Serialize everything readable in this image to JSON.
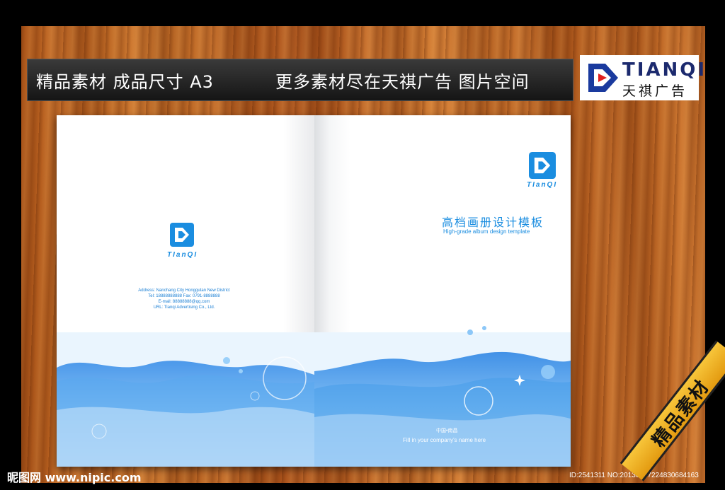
{
  "header": {
    "left_text": "精品素材 成品尺寸 A3",
    "right_text": "更多素材尽在天祺广告 图片空间"
  },
  "brand": {
    "name_en": "TIANQI",
    "name_cn": "天祺广告",
    "colors": {
      "blue": "#1a3a9e",
      "red": "#e02020"
    }
  },
  "left_page": {
    "logo_text": "TIanQI",
    "contact": {
      "address": "Address: Nanchang City Honggutan New District",
      "tel": "Tel: 18888888888      Fax: 0791-8888888",
      "email": "E-mail: 88888888@qq.com",
      "url": "URL: Tianqi Advertising Co., Ltd."
    }
  },
  "right_page": {
    "logo_text": "TIanQI",
    "title_cn": "高档画册设计模板",
    "title_en": "High-grade album design template",
    "bottom_cn": "中国•南昌",
    "bottom_en": "Fill in your company's name here"
  },
  "footer": {
    "site": "昵图网 www.nipic.com",
    "id_text": "ID:2541311 NO:20130707224830684163"
  },
  "ribbon": {
    "text": "精品素材"
  }
}
